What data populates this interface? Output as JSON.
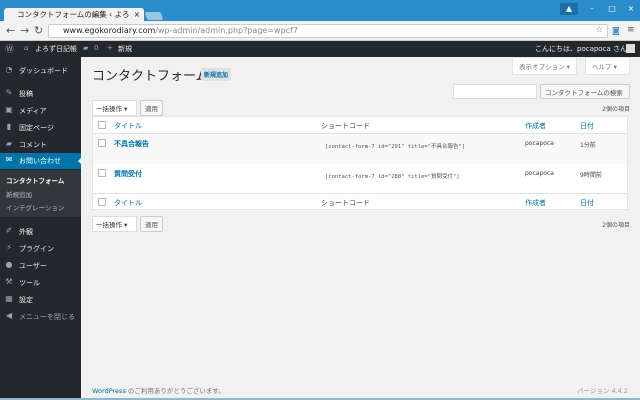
{
  "browser": {
    "tab_title": "コンタクトフォームの編集 ‹ よろ",
    "url_host": "www.egokorodiary.com",
    "url_path": "/wp-admin/admin.php?page=wpcf7"
  },
  "adminbar": {
    "site": "よろず日記帳",
    "comments": "0",
    "new": "新規",
    "greeting": "こんにちは、pocapoca さん！"
  },
  "sidebar": {
    "items": [
      {
        "label": "ダッシュボード",
        "icon": "dashboard-icon"
      },
      {
        "label": "投稿",
        "icon": "pin-icon"
      },
      {
        "label": "メディア",
        "icon": "media-icon"
      },
      {
        "label": "固定ページ",
        "icon": "page-icon"
      },
      {
        "label": "コメント",
        "icon": "comment-icon"
      },
      {
        "label": "お問い合わせ",
        "icon": "mail-icon"
      },
      {
        "label": "外観",
        "icon": "brush-icon"
      },
      {
        "label": "プラグイン",
        "icon": "plugin-icon"
      },
      {
        "label": "ユーザー",
        "icon": "user-icon"
      },
      {
        "label": "ツール",
        "icon": "wrench-icon"
      },
      {
        "label": "設定",
        "icon": "settings-icon"
      },
      {
        "label": "メニューを閉じる",
        "icon": "collapse-icon"
      }
    ],
    "submenu": [
      "コンタクトフォーム",
      "新規追加",
      "インテグレーション"
    ]
  },
  "main": {
    "title": "コンタクトフォーム",
    "add_new": "新規追加",
    "screen_options": "表示オプション ▾",
    "help": "ヘルプ ▾",
    "search_button": "コンタクトフォームの検索",
    "search_value": "",
    "bulk_action": "一括操作",
    "apply": "適用",
    "count": "2個の項目",
    "columns": [
      "タイトル",
      "ショートコード",
      "作成者",
      "日付"
    ],
    "rows": [
      {
        "title": "不具合報告",
        "shortcode": "[contact-form-7 id=\"291\" title=\"不具合報告\"]",
        "author": "pocapoca",
        "date": "1分前"
      },
      {
        "title": "質問受付",
        "shortcode": "[contact-form-7 id=\"288\" title=\"質問受付\"]",
        "author": "pocapoca",
        "date": "9時間前"
      }
    ]
  },
  "footer": {
    "link": "WordPress",
    "text": " のご利用ありがとうございます。",
    "version": "バージョン 4.4.2"
  }
}
